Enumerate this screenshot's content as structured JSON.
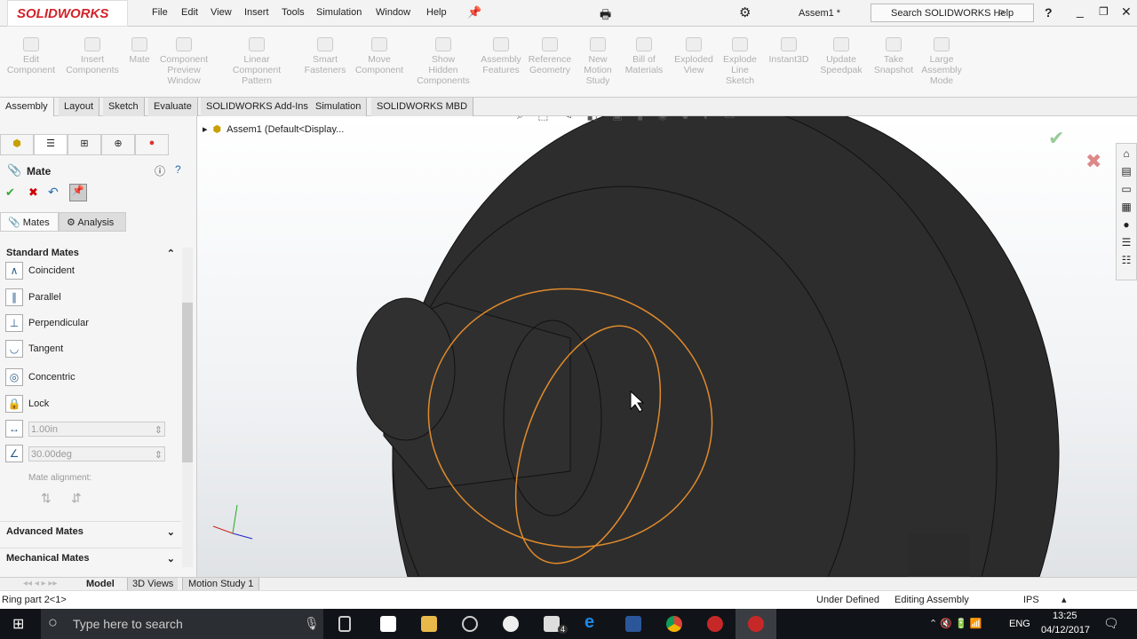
{
  "app": {
    "brand": "SOLIDWORKS",
    "doc_title": "Assem1 *",
    "search_placeholder": "Search SOLIDWORKS Help",
    "help": "?"
  },
  "menu": [
    "File",
    "Edit",
    "View",
    "Insert",
    "Tools",
    "Simulation",
    "Window",
    "Help"
  ],
  "commands": [
    {
      "l1": "Edit",
      "l2": "Component",
      "l3": ""
    },
    {
      "l1": "Insert",
      "l2": "Components",
      "l3": ""
    },
    {
      "l1": "Mate",
      "l2": "",
      "l3": ""
    },
    {
      "l1": "Component",
      "l2": "Preview",
      "l3": "Window"
    },
    {
      "l1": "Linear Component",
      "l2": "Pattern",
      "l3": ""
    },
    {
      "l1": "Smart",
      "l2": "Fasteners",
      "l3": ""
    },
    {
      "l1": "Move",
      "l2": "Component",
      "l3": ""
    },
    {
      "l1": "Show",
      "l2": "Hidden",
      "l3": "Components"
    },
    {
      "l1": "Assembly",
      "l2": "Features",
      "l3": ""
    },
    {
      "l1": "Reference",
      "l2": "Geometry",
      "l3": ""
    },
    {
      "l1": "New",
      "l2": "Motion",
      "l3": "Study"
    },
    {
      "l1": "Bill of",
      "l2": "Materials",
      "l3": ""
    },
    {
      "l1": "Exploded",
      "l2": "View",
      "l3": ""
    },
    {
      "l1": "Explode",
      "l2": "Line",
      "l3": "Sketch"
    },
    {
      "l1": "Instant3D",
      "l2": "",
      "l3": ""
    },
    {
      "l1": "Update",
      "l2": "Speedpak",
      "l3": ""
    },
    {
      "l1": "Take",
      "l2": "Snapshot",
      "l3": ""
    },
    {
      "l1": "Large",
      "l2": "Assembly",
      "l3": "Mode"
    }
  ],
  "tabs": [
    "Assembly",
    "Layout",
    "Sketch",
    "Evaluate",
    "SOLIDWORKS Add-Ins",
    "Simulation",
    "SOLIDWORKS MBD"
  ],
  "tree": {
    "root": "Assem1  (Default<Display..."
  },
  "panel": {
    "title": "Mate",
    "subtabs": [
      "Mates",
      "Analysis"
    ],
    "standard_header": "Standard Mates",
    "mates": [
      "Coincident",
      "Parallel",
      "Perpendicular",
      "Tangent",
      "Concentric",
      "Lock"
    ],
    "distance": "1.00in",
    "angle": "30.00deg",
    "alignment_label": "Mate alignment:",
    "advanced": "Advanced Mates",
    "mechanical": "Mechanical Mates"
  },
  "bottom_tabs": [
    "Model",
    "3D Views",
    "Motion Study 1"
  ],
  "status": {
    "selection": "Ring part 2<1>",
    "state": "Under Defined",
    "mode": "Editing Assembly",
    "units": "IPS"
  },
  "taskbar": {
    "search_placeholder": "Type here to search",
    "lang": "ENG",
    "time": "13:25",
    "date": "04/12/2017",
    "mail_badge": "4"
  },
  "colors": {
    "brand": "#d2232a",
    "selection": "#e08a2c",
    "model": "#2b2b2b"
  }
}
